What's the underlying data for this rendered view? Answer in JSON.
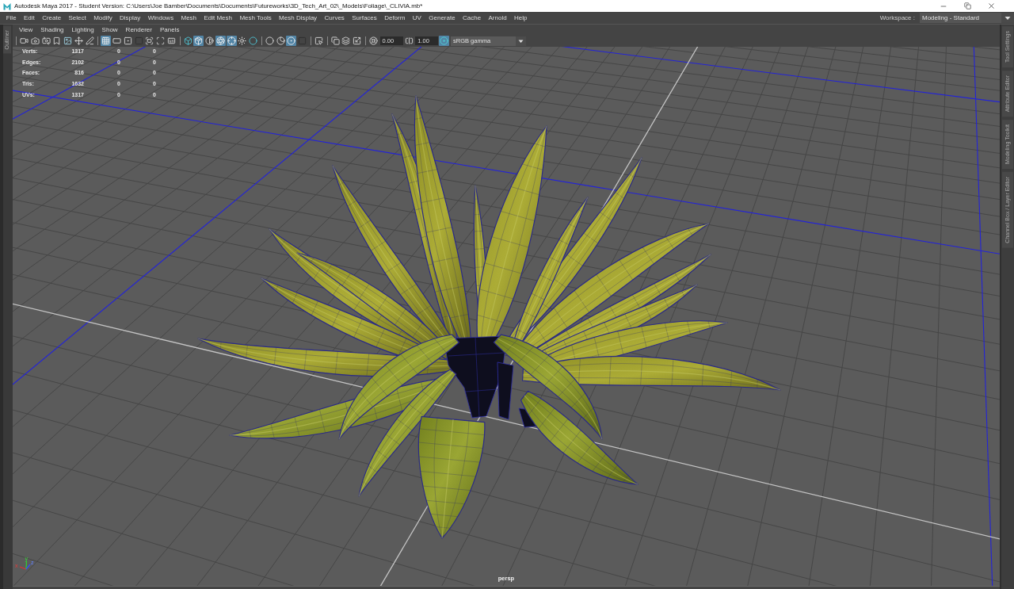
{
  "window": {
    "title": "Autodesk Maya 2017 - Student Version: C:\\Users\\Joe Bamber\\Documents\\Documents\\Futureworks\\3D_Tech_Art_02\\_Models\\Foliage\\_CLIVIA.mb*"
  },
  "menu_bar": {
    "items": [
      "File",
      "Edit",
      "Create",
      "Select",
      "Modify",
      "Display",
      "Windows",
      "Mesh",
      "Edit Mesh",
      "Mesh Tools",
      "Mesh Display",
      "Curves",
      "Surfaces",
      "Deform",
      "UV",
      "Generate",
      "Cache",
      "Arnold",
      "Help"
    ]
  },
  "workspace": {
    "label": "Workspace :",
    "value": "Modeling - Standard"
  },
  "left_tabs": [
    {
      "label": "Outliner"
    }
  ],
  "panel": {
    "menu": [
      "View",
      "Shading",
      "Lighting",
      "Show",
      "Renderer",
      "Panels"
    ],
    "toolbar": [
      {
        "kind": "separator"
      },
      {
        "kind": "button",
        "on": false
      },
      {
        "kind": "button",
        "on": false
      },
      {
        "kind": "button",
        "on": false
      },
      {
        "kind": "button",
        "on": false
      },
      {
        "kind": "button",
        "on": false
      },
      {
        "kind": "button",
        "on": false
      },
      {
        "kind": "button",
        "on": false
      },
      {
        "kind": "separator"
      },
      {
        "kind": "button",
        "on": true
      },
      {
        "kind": "button",
        "on": false
      },
      {
        "kind": "button",
        "on": false
      },
      {
        "kind": "button",
        "on": false
      },
      {
        "kind": "button",
        "on": false
      },
      {
        "kind": "button",
        "on": false
      },
      {
        "kind": "button",
        "on": false
      },
      {
        "kind": "separator"
      },
      {
        "kind": "button",
        "on": false
      },
      {
        "kind": "button",
        "on": true
      },
      {
        "kind": "button",
        "on": false
      },
      {
        "kind": "button",
        "on": true
      },
      {
        "kind": "button",
        "on": true
      },
      {
        "kind": "button",
        "on": false
      },
      {
        "kind": "button",
        "on": false
      },
      {
        "kind": "separator"
      },
      {
        "kind": "button",
        "on": false
      },
      {
        "kind": "button",
        "on": false
      },
      {
        "kind": "button",
        "on": true
      },
      {
        "kind": "button",
        "on": false
      },
      {
        "kind": "separator"
      },
      {
        "kind": "button",
        "on": false
      },
      {
        "kind": "separator"
      },
      {
        "kind": "button",
        "on": false
      },
      {
        "kind": "button",
        "on": false
      },
      {
        "kind": "button",
        "on": false
      },
      {
        "kind": "separator"
      },
      {
        "kind": "button",
        "on": false
      },
      {
        "kind": "field",
        "value": "0.00"
      },
      {
        "kind": "button",
        "on": false
      },
      {
        "kind": "field",
        "value": "1.00"
      },
      {
        "kind": "button",
        "on": true
      },
      {
        "kind": "dropdown",
        "value": "sRGB gamma"
      }
    ],
    "hud": {
      "rows": [
        {
          "label": "Verts:",
          "values": [
            "1317",
            "0",
            "0"
          ]
        },
        {
          "label": "Edges:",
          "values": [
            "2102",
            "0",
            "0"
          ]
        },
        {
          "label": "Faces:",
          "values": [
            "816",
            "0",
            "0"
          ]
        },
        {
          "label": "Tris:",
          "values": [
            "1632",
            "0",
            "0"
          ]
        },
        {
          "label": "UVs:",
          "values": [
            "1317",
            "0",
            "0"
          ]
        }
      ]
    },
    "axis_labels": [
      "x",
      "y",
      "z"
    ],
    "camera_label": "persp"
  },
  "right_tabs": [
    {
      "label": "Tool Settings"
    },
    {
      "label": "Attribute Editor"
    },
    {
      "label": "Modeling Toolkit"
    },
    {
      "label": "Channel Box / Layer Editor"
    }
  ]
}
